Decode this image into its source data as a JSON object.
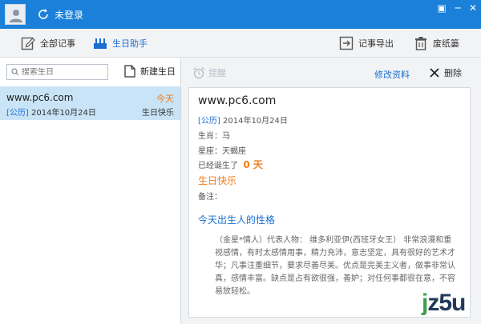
{
  "titlebar": {
    "login_status": "未登录",
    "window_buttons": [
      "restore",
      "minimize",
      "close"
    ]
  },
  "toolbar": {
    "all_notes": "全部记事",
    "birthday_helper": "生日助手",
    "export": "记事导出",
    "trash": "废纸篓"
  },
  "sidebar": {
    "search_placeholder": "搜索生日",
    "new_birthday": "新建生日",
    "items": [
      {
        "name": "www.pc6.com",
        "calendar_tag": "[公历]",
        "date": "2014年10月24日",
        "badge": "今天",
        "status": "生日快乐"
      }
    ]
  },
  "detail": {
    "remind": "提醒",
    "edit": "修改资料",
    "delete": "删除",
    "name": "www.pc6.com",
    "calendar_tag": "[公历]",
    "date": "2014年10月24日",
    "zodiac": "生肖：马",
    "constellation": "星座：天蝎座",
    "born_prefix": "已经诞生了",
    "born_days": "0 天",
    "happy": "生日快乐",
    "note": "备注：",
    "personality_title": "今天出生人的性格",
    "personality_text": "（金星*情人）代表人物： 维多利亚伊(西班牙女王） 非常浪漫和重视感情，有时太感情用事，精力充沛，意志坚定，具有很好的艺术才华；凡事注重细节，要求尽善尽美。优点是完美主义者，做事非常认真，感情丰富。缺点是占有欲很强，善妒；对任何事都很在意，不容易放轻松。"
  },
  "watermark": {
    "text": "jz5u",
    "accent_color": "#3aa04a"
  },
  "colors": {
    "titlebar": "#1a80d9",
    "accent_blue": "#1a6fd1",
    "accent_orange": "#f07e17",
    "selected_row": "#c9e4f7"
  }
}
